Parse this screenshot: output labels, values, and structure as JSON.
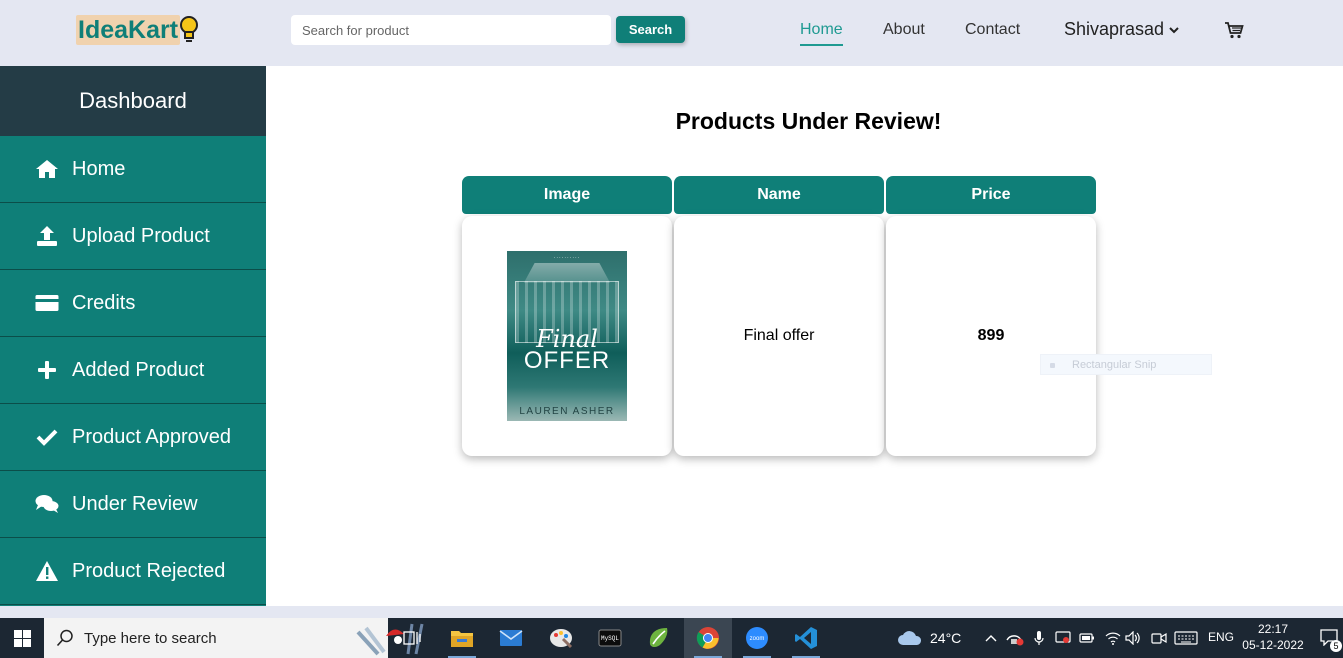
{
  "brand": {
    "name": "IdeaKart"
  },
  "search": {
    "placeholder": "Search for product",
    "button_label": "Search"
  },
  "nav": {
    "links": [
      {
        "label": "Home",
        "active": true
      },
      {
        "label": "About",
        "active": false
      },
      {
        "label": "Contact",
        "active": false
      }
    ],
    "user": "Shivaprasad",
    "cart_icon": "cart-icon"
  },
  "sidebar": {
    "title": "Dashboard",
    "items": [
      {
        "label": "Home",
        "icon": "home-icon"
      },
      {
        "label": "Upload Product",
        "icon": "upload-icon"
      },
      {
        "label": "Credits",
        "icon": "credit-card-icon"
      },
      {
        "label": "Added Product",
        "icon": "plus-icon"
      },
      {
        "label": "Product Approved",
        "icon": "check-icon"
      },
      {
        "label": "Under Review",
        "icon": "comments-icon"
      },
      {
        "label": "Product Rejected",
        "icon": "warning-icon"
      }
    ]
  },
  "main": {
    "title": "Products Under Review!",
    "table": {
      "columns": [
        "Image",
        "Name",
        "Price"
      ],
      "rows": [
        {
          "image": {
            "cover_script": "Final",
            "cover_title": "OFFER",
            "cover_author": "LAUREN ASHER"
          },
          "name": "Final offer",
          "price": "899"
        }
      ]
    },
    "overlay_hint": "Rectangular Snip"
  },
  "colors": {
    "brand": "#0f7f78",
    "sidebar_head": "#243c46",
    "nav_bg": "#e4e7f2",
    "active_link": "#1f9a92"
  },
  "taskbar": {
    "search_placeholder": "Type here to search",
    "weather": "24°C",
    "language": "ENG",
    "time": "22:17",
    "date": "05-12-2022",
    "notification_count": "5",
    "apps": [
      "task-view-icon",
      "file-explorer-icon",
      "mail-icon",
      "paint-icon",
      "terminal-icon",
      "spring-icon",
      "chrome-icon",
      "zoom-icon",
      "vscode-icon"
    ]
  }
}
